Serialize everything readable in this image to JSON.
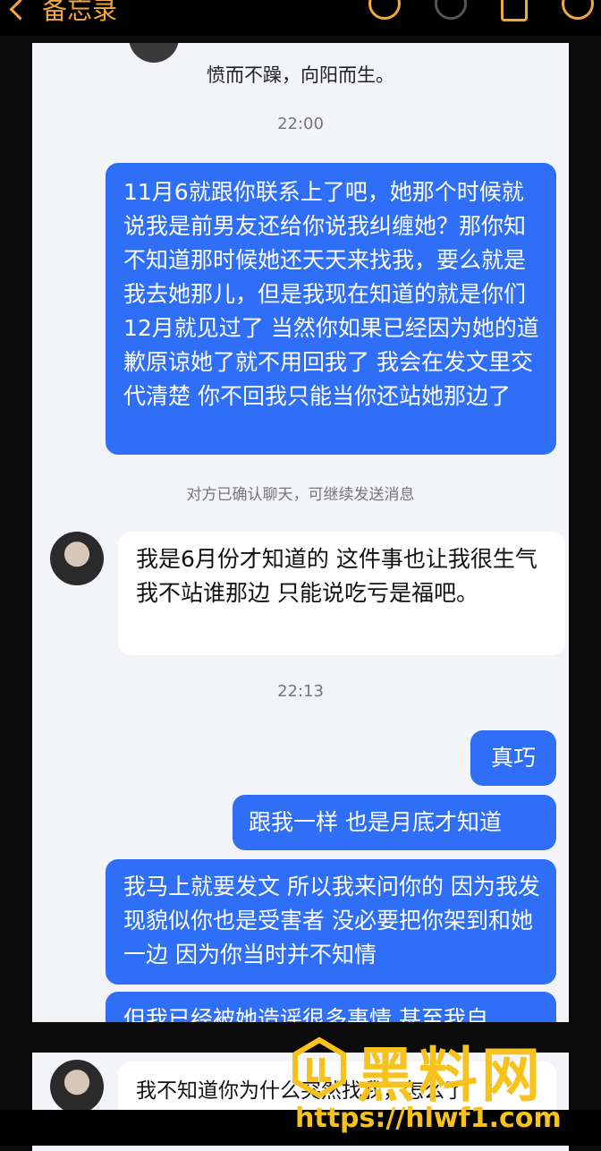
{
  "nav": {
    "back_label": "备忘录"
  },
  "chat": {
    "signature": "愤而不躁，向阳而生。",
    "time_1": "22:00",
    "msg_out_1": "11月6就跟你联系上了吧，她那个时候就说我是前男友还给你说我纠缠她？那你知不知道那时候她还天天来找我，要么就是我去她那儿，但是我现在知道的就是你们12月就见过了 当然你如果已经因为她的道歉原谅她了就不用回我了 我会在发文里交代清楚 你不回我只能当你还站她那边了",
    "system_notice": "对方已确认聊天，可继续发送消息",
    "msg_in_1": "我是6月份才知道的 这件事也让我很生气 我不站谁那边 只能说吃亏是福吧。",
    "time_2": "22:13",
    "msg_out_2": "真巧",
    "msg_out_3": "跟我一样 也是月底才知道",
    "msg_out_4": "我马上就要发文 所以我来问你的 因为我发现貌似你也是受害者 没必要把你架到和她一边 因为你当时并不知情",
    "msg_out_5_partial": "但我已经被她造谣很多事情 甚至我自",
    "msg_in_2_partial": "我不知道你为什么突然找我，怎么了"
  },
  "watermark": {
    "title": "黑料网",
    "url": "https://hlwf1.com"
  },
  "colors": {
    "accent": "#f2a93b",
    "bubble_out": "#2f6ef7",
    "watermark": "#f7c21b"
  }
}
